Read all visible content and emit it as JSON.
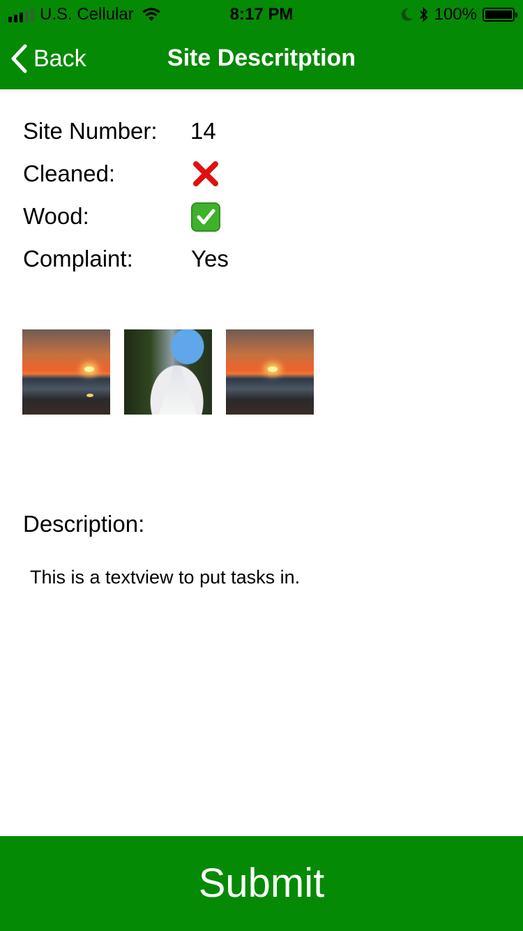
{
  "status_bar": {
    "carrier": "U.S. Cellular",
    "time": "8:17 PM",
    "battery": "100%"
  },
  "nav": {
    "back_label": "Back",
    "title": "Site Descritption"
  },
  "fields": [
    {
      "label": "Site Number:",
      "value": "14"
    },
    {
      "label": "Cleaned:",
      "value_icon": "red-x-icon"
    },
    {
      "label": "Wood:",
      "value_icon": "green-check-icon"
    },
    {
      "label": "Complaint:",
      "value": "Yes"
    }
  ],
  "photos": [
    "sunset-photo",
    "beach-path-photo",
    "sunset-photo"
  ],
  "description": {
    "label": "Description:",
    "text": "This is a textview to put tasks in."
  },
  "submit_label": "Submit",
  "colors": {
    "accent": "#058a05",
    "x_red": "#e01010",
    "check_green": "#3fb12c"
  }
}
